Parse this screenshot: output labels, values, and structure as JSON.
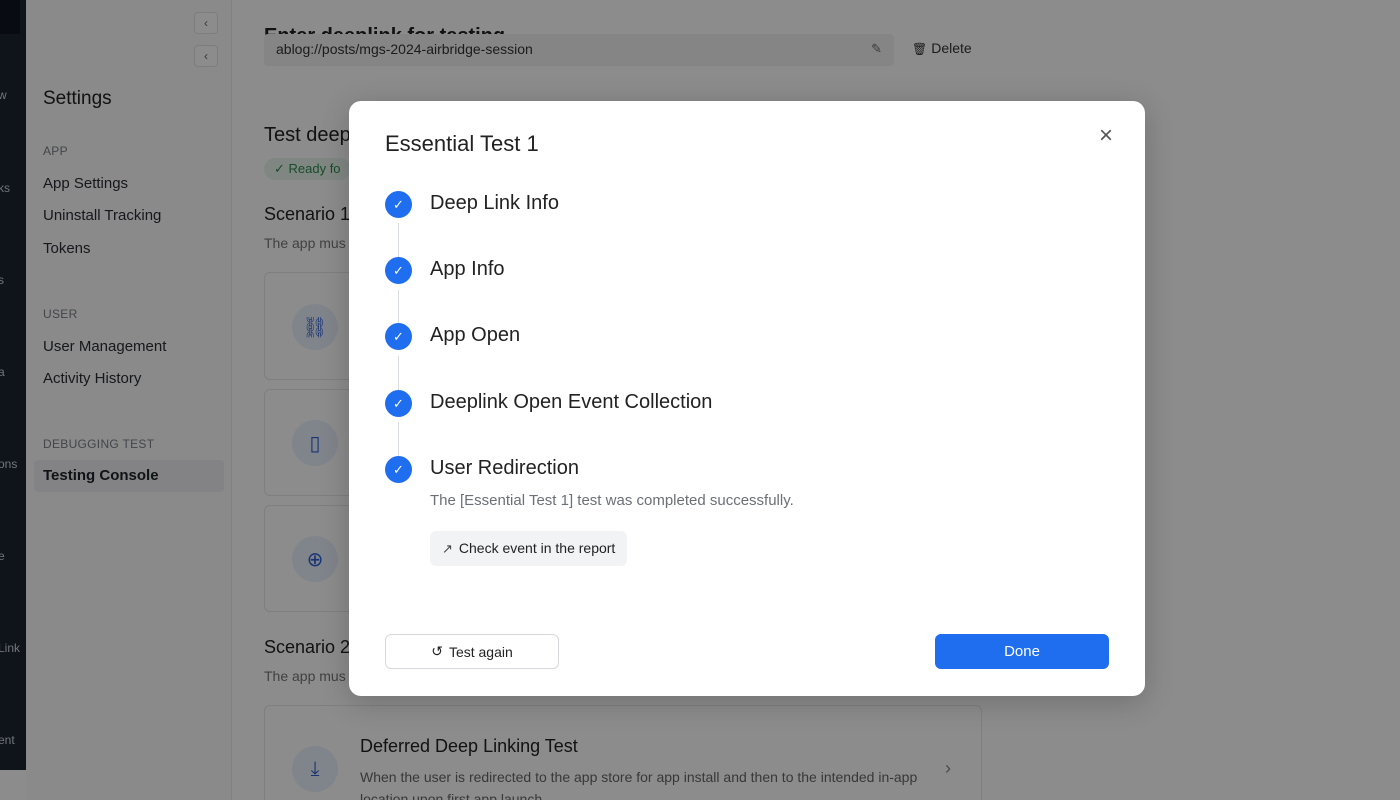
{
  "nav_strip": {
    "fragments": [
      "w",
      "ks",
      "s",
      "a",
      "ons",
      "e",
      "Link",
      "ent"
    ]
  },
  "sidebar": {
    "title": "Settings",
    "collapse_icon": "chevron-left-icon",
    "sections": [
      {
        "label": "APP",
        "items": [
          "App Settings",
          "Uninstall Tracking",
          "Tokens"
        ]
      },
      {
        "label": "USER",
        "items": [
          "User Management",
          "Activity History"
        ]
      },
      {
        "label": "DEBUGGING TEST",
        "items": [
          "Testing Console"
        ]
      }
    ],
    "active_item": "Testing Console"
  },
  "main": {
    "cut_heading": "Enter deeplink for testing",
    "url_value": "ablog://posts/mgs-2024-airbridge-session",
    "delete_label": "Delete",
    "test_heading": "Test deep",
    "ready_badge": "✓ Ready fo",
    "scenario1_title": "Scenario 1",
    "scenario1_desc": "The app mus",
    "scenario2_title": "Scenario 2",
    "scenario2_desc": "The app mus",
    "deferred_card": {
      "title": "Deferred Deep Linking Test",
      "desc": "When the user is redirected to the app store for app install and then to the intended in-app location upon first app launch"
    }
  },
  "modal": {
    "title": "Essential Test 1",
    "steps": [
      "Deep Link Info",
      "App Info",
      "App Open",
      "Deeplink Open Event Collection",
      "User Redirection"
    ],
    "success_message": "The [Essential Test 1] test was completed successfully.",
    "report_button": "Check event in the report",
    "test_again_button": "Test again",
    "done_button": "Done"
  },
  "colors": {
    "accent": "#1f6ef0",
    "overlay": "rgba(0,0,0,0.45)",
    "nav_dark": "#1c2430"
  }
}
